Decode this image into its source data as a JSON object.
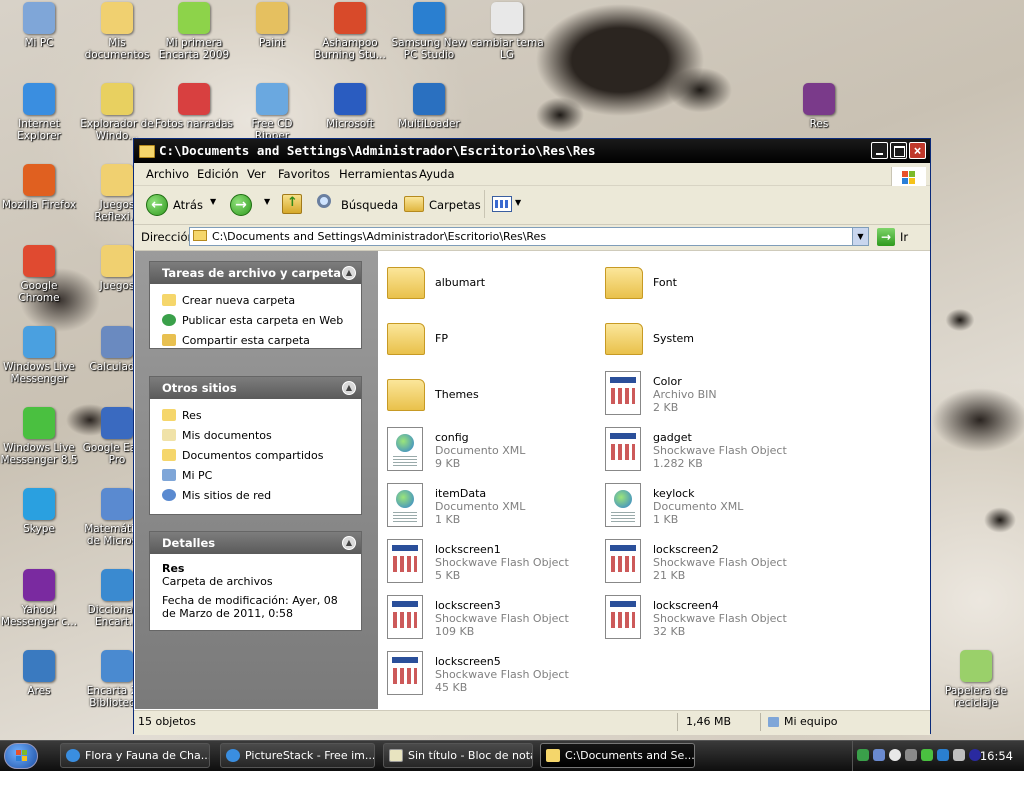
{
  "desktop": {
    "icons": [
      {
        "label": "Mi PC",
        "color": "#7fa6d8"
      },
      {
        "label": "Mis documentos",
        "color": "#f0d070"
      },
      {
        "label": "Mi primera Encarta 2009",
        "color": "#8dd34a"
      },
      {
        "label": "Paint",
        "color": "#e5c060"
      },
      {
        "label": "Ashampoo Burning Stu...",
        "color": "#d84a2a"
      },
      {
        "label": "Samsung New PC Studio",
        "color": "#2a7fd0"
      },
      {
        "label": "cambiar tema LG",
        "color": "#e8e8e8"
      },
      {
        "label": "Internet Explorer",
        "color": "#3a8ee0"
      },
      {
        "label": "Explorador de Windo...",
        "color": "#e8d060"
      },
      {
        "label": "Fotos narradas",
        "color": "#d84040"
      },
      {
        "label": "Free CD Ripper",
        "color": "#6aa8e0"
      },
      {
        "label": "Microsoft",
        "color": "#2a5cc0"
      },
      {
        "label": "MultiLoader",
        "color": "#2a70c0"
      },
      {
        "label": "Res",
        "color": "#7a3a8a"
      },
      {
        "label": "Mozilla Firefox",
        "color": "#e06020"
      },
      {
        "label": "Juegos Reflexi...",
        "color": "#f0d070"
      },
      {
        "label": "Google Chrome",
        "color": "#e04a30"
      },
      {
        "label": "Juegos",
        "color": "#f0d070"
      },
      {
        "label": "Windows Live Messenger",
        "color": "#4aa0e0"
      },
      {
        "label": "Calculad...",
        "color": "#6a8ac0"
      },
      {
        "label": "Windows Live Messenger 8.5",
        "color": "#4ac040"
      },
      {
        "label": "Google Earth Pro",
        "color": "#3a6ac0"
      },
      {
        "label": "Skype",
        "color": "#2aa0e0"
      },
      {
        "label": "Matemátic... de Micros...",
        "color": "#5a8ad0"
      },
      {
        "label": "Yahoo! Messenger c...",
        "color": "#7a2aa0"
      },
      {
        "label": "Diccionario Encart...",
        "color": "#3a8ad0"
      },
      {
        "label": "Ares",
        "color": "#3a7ac0"
      },
      {
        "label": "Encarta 2... Bibliotec...",
        "color": "#4a8ad0"
      },
      {
        "label": "Papelera de reciclaje",
        "color": "#9ad06a"
      }
    ]
  },
  "window": {
    "title": "C:\\Documents and Settings\\Administrador\\Escritorio\\Res\\Res",
    "menu": [
      "Archivo",
      "Edición",
      "Ver",
      "Favoritos",
      "Herramientas",
      "Ayuda"
    ],
    "toolbar": {
      "back": "Atrás",
      "search": "Búsqueda",
      "folders": "Carpetas"
    },
    "address": {
      "label": "Dirección",
      "value": "C:\\Documents and Settings\\Administrador\\Escritorio\\Res\\Res",
      "go": "Ir"
    },
    "tasks_panel": {
      "title": "Tareas de archivo y carpeta",
      "links": [
        "Crear nueva carpeta",
        "Publicar esta carpeta en Web",
        "Compartir esta carpeta"
      ]
    },
    "other_places": {
      "title": "Otros sitios",
      "links": [
        "Res",
        "Mis documentos",
        "Documentos compartidos",
        "Mi PC",
        "Mis sitios de red"
      ]
    },
    "details": {
      "title": "Detalles",
      "name": "Res",
      "type": "Carpeta de archivos",
      "modified": "Fecha de modificación: Ayer, 08 de Marzo de 2011, 0:58"
    },
    "items": [
      {
        "name": "albumart",
        "type": "",
        "size": "",
        "kind": "folder"
      },
      {
        "name": "Font",
        "type": "",
        "size": "",
        "kind": "folder"
      },
      {
        "name": "FP",
        "type": "",
        "size": "",
        "kind": "folder"
      },
      {
        "name": "System",
        "type": "",
        "size": "",
        "kind": "folder"
      },
      {
        "name": "Themes",
        "type": "",
        "size": "",
        "kind": "folder"
      },
      {
        "name": "Color",
        "type": "Archivo BIN",
        "size": "2 KB",
        "kind": "bin"
      },
      {
        "name": "config",
        "type": "Documento XML",
        "size": "9 KB",
        "kind": "xml"
      },
      {
        "name": "gadget",
        "type": "Shockwave Flash Object",
        "size": "1.282 KB",
        "kind": "swf"
      },
      {
        "name": "itemData",
        "type": "Documento XML",
        "size": "1 KB",
        "kind": "xml"
      },
      {
        "name": "keylock",
        "type": "Documento XML",
        "size": "1 KB",
        "kind": "xml"
      },
      {
        "name": "lockscreen1",
        "type": "Shockwave Flash Object",
        "size": "5 KB",
        "kind": "swf"
      },
      {
        "name": "lockscreen2",
        "type": "Shockwave Flash Object",
        "size": "21 KB",
        "kind": "swf"
      },
      {
        "name": "lockscreen3",
        "type": "Shockwave Flash Object",
        "size": "109 KB",
        "kind": "swf"
      },
      {
        "name": "lockscreen4",
        "type": "Shockwave Flash Object",
        "size": "32 KB",
        "kind": "swf"
      },
      {
        "name": "lockscreen5",
        "type": "Shockwave Flash Object",
        "size": "45 KB",
        "kind": "swf"
      }
    ],
    "status": {
      "count": "15 objetos",
      "size": "1,46 MB",
      "location": "Mi equipo"
    }
  },
  "taskbar": {
    "tasks": [
      "Flora y Fauna de Cha...",
      "PictureStack - Free im...",
      "Sin título - Bloc de notas",
      "C:\\Documents and Se..."
    ],
    "clock": "16:54"
  }
}
